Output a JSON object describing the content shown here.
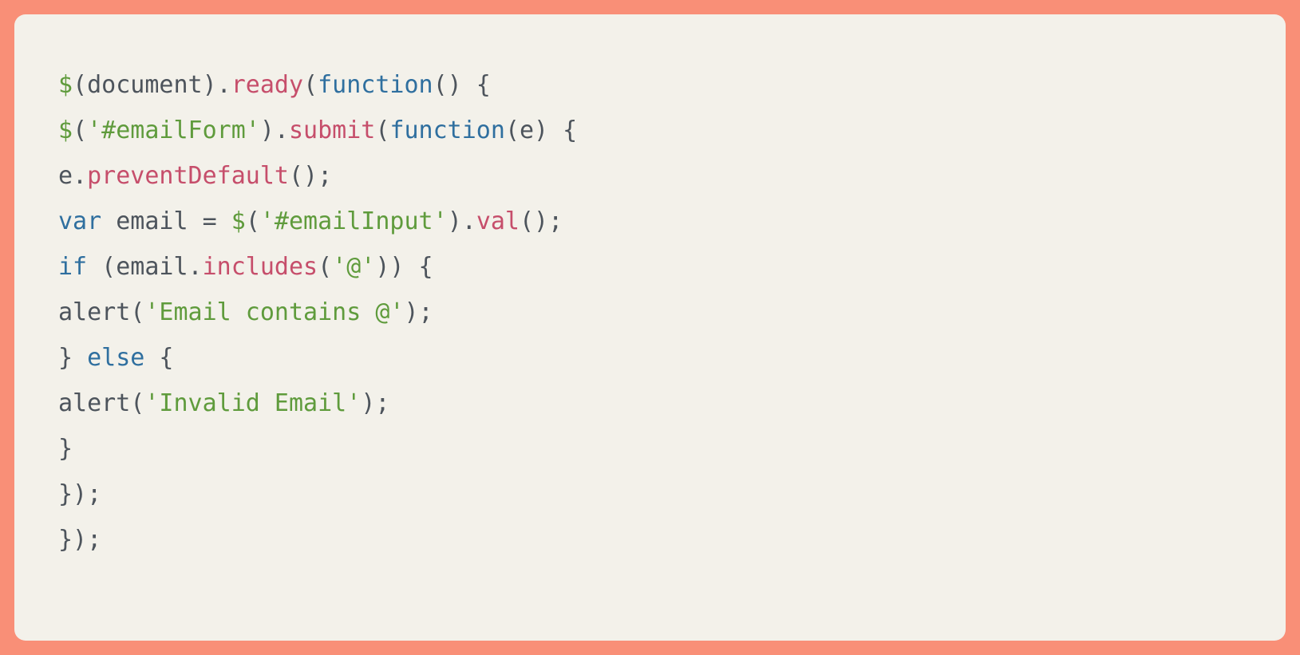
{
  "code": {
    "lines": [
      [
        {
          "cls": "tok-dollar",
          "t": "$"
        },
        {
          "cls": "tok-ident",
          "t": "(document)."
        },
        {
          "cls": "tok-func",
          "t": "ready"
        },
        {
          "cls": "tok-ident",
          "t": "("
        },
        {
          "cls": "tok-keyword",
          "t": "function"
        },
        {
          "cls": "tok-ident",
          "t": "() {"
        }
      ],
      [
        {
          "cls": "tok-dollar",
          "t": "$"
        },
        {
          "cls": "tok-ident",
          "t": "("
        },
        {
          "cls": "tok-string",
          "t": "'#emailForm'"
        },
        {
          "cls": "tok-ident",
          "t": ")."
        },
        {
          "cls": "tok-func",
          "t": "submit"
        },
        {
          "cls": "tok-ident",
          "t": "("
        },
        {
          "cls": "tok-keyword",
          "t": "function"
        },
        {
          "cls": "tok-ident",
          "t": "(e) {"
        }
      ],
      [
        {
          "cls": "tok-ident",
          "t": "e."
        },
        {
          "cls": "tok-func",
          "t": "preventDefault"
        },
        {
          "cls": "tok-ident",
          "t": "();"
        }
      ],
      [
        {
          "cls": "tok-keyword",
          "t": "var"
        },
        {
          "cls": "tok-ident",
          "t": " email = "
        },
        {
          "cls": "tok-dollar",
          "t": "$"
        },
        {
          "cls": "tok-ident",
          "t": "("
        },
        {
          "cls": "tok-string",
          "t": "'#emailInput'"
        },
        {
          "cls": "tok-ident",
          "t": ")."
        },
        {
          "cls": "tok-func",
          "t": "val"
        },
        {
          "cls": "tok-ident",
          "t": "();"
        }
      ],
      [
        {
          "cls": "tok-keyword",
          "t": "if"
        },
        {
          "cls": "tok-ident",
          "t": " (email."
        },
        {
          "cls": "tok-func",
          "t": "includes"
        },
        {
          "cls": "tok-ident",
          "t": "("
        },
        {
          "cls": "tok-string",
          "t": "'@'"
        },
        {
          "cls": "tok-ident",
          "t": ")) {"
        }
      ],
      [
        {
          "cls": "tok-ident",
          "t": "alert("
        },
        {
          "cls": "tok-string",
          "t": "'Email contains @'"
        },
        {
          "cls": "tok-ident",
          "t": ");"
        }
      ],
      [
        {
          "cls": "tok-ident",
          "t": "} "
        },
        {
          "cls": "tok-keyword",
          "t": "else"
        },
        {
          "cls": "tok-ident",
          "t": " {"
        }
      ],
      [
        {
          "cls": "tok-ident",
          "t": "alert("
        },
        {
          "cls": "tok-string",
          "t": "'Invalid Email'"
        },
        {
          "cls": "tok-ident",
          "t": ");"
        }
      ],
      [
        {
          "cls": "tok-ident",
          "t": "}"
        }
      ],
      [
        {
          "cls": "tok-ident",
          "t": "});"
        }
      ],
      [
        {
          "cls": "tok-ident",
          "t": "});"
        }
      ]
    ]
  },
  "colors": {
    "frame": "#f98f77",
    "panel": "#f3f1ea",
    "text": "#4d545c",
    "keyword": "#2f6f9f",
    "func": "#c64e6b",
    "string": "#5f9b3c"
  }
}
